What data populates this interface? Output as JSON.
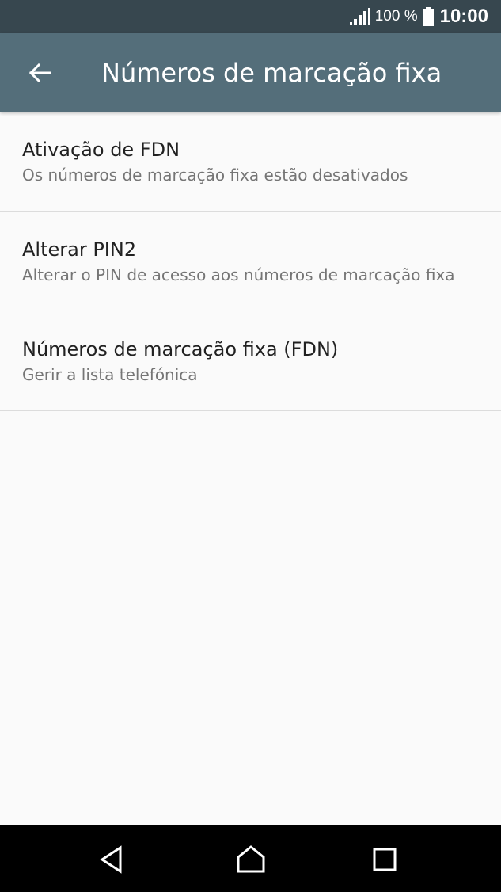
{
  "status_bar": {
    "battery_percent": "100 %",
    "time": "10:00",
    "icons": [
      "signal-icon",
      "battery-icon"
    ]
  },
  "app_bar": {
    "title": "Números de marcação fixa",
    "back_icon": "arrow-back-icon"
  },
  "items": [
    {
      "label": "Ativação de FDN",
      "summary": "Os números de marcação fixa estão desativados"
    },
    {
      "label": "Alterar PIN2",
      "summary": "Alterar o PIN de acesso aos números de marcação fixa"
    },
    {
      "label": "Números de marcação fixa (FDN)",
      "summary": "Gerir a lista telefónica"
    }
  ],
  "nav_bar": {
    "buttons": [
      "back-triangle-icon",
      "home-icon",
      "recents-square-icon"
    ]
  },
  "colors": {
    "status_bar": "#37474f",
    "app_bar": "#546e7a",
    "background": "#fafafa",
    "nav_bar": "#000000"
  }
}
